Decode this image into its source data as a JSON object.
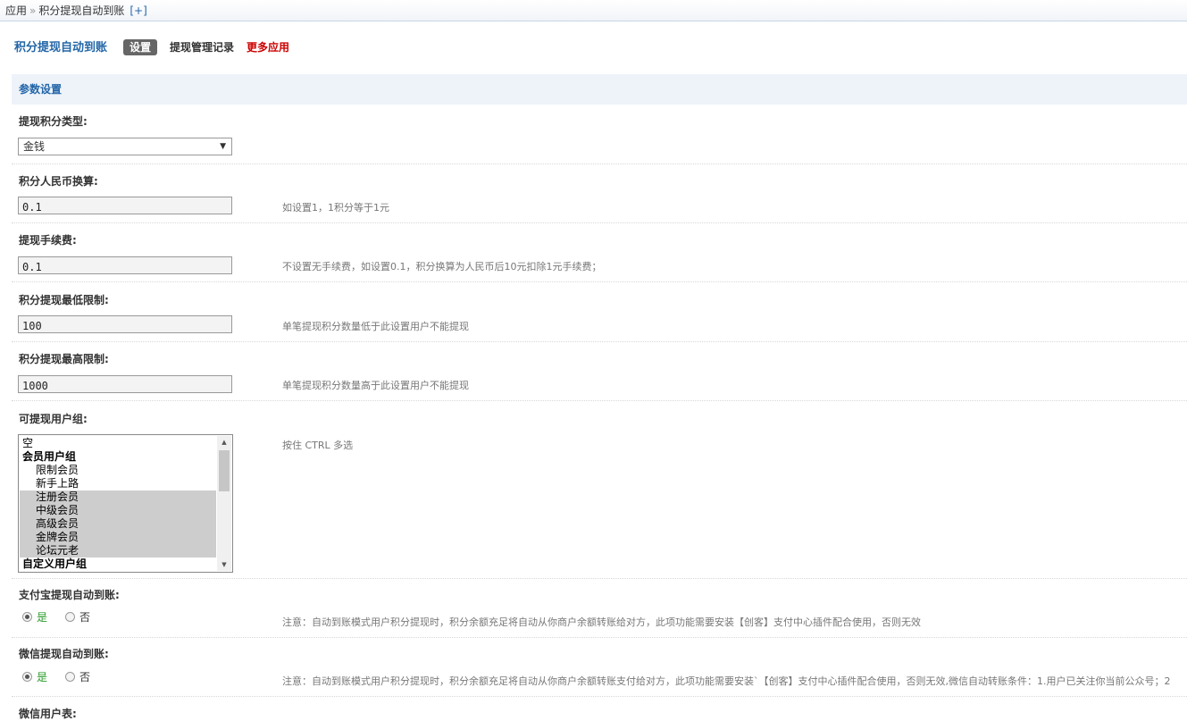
{
  "breadcrumb": {
    "root": "应用",
    "separator": "»",
    "current": "积分提现自动到账",
    "add": "[+]"
  },
  "header": {
    "title": "积分提现自动到账",
    "tabs": [
      {
        "label": "设置",
        "active": true
      },
      {
        "label": "提现管理记录",
        "active": false
      },
      {
        "label": "更多应用",
        "active": false,
        "color": "#cc0000"
      }
    ]
  },
  "section": {
    "title": "参数设置"
  },
  "settings": {
    "type": {
      "label": "提现积分类型:",
      "value": "金钱"
    },
    "rate": {
      "label": "积分人民币换算:",
      "value": "0.1",
      "tip": "如设置1，1积分等于1元"
    },
    "fee": {
      "label": "提现手续费:",
      "value": "0.1",
      "tip": "不设置无手续费，如设置0.1，积分换算为人民币后10元扣除1元手续费；"
    },
    "min": {
      "label": "积分提现最低限制:",
      "value": "100",
      "tip": "单笔提现积分数量低于此设置用户不能提现"
    },
    "max": {
      "label": "积分提现最高限制:",
      "value": "1000",
      "tip": "单笔提现积分数量高于此设置用户不能提现"
    },
    "groups": {
      "label": "可提现用户组:",
      "tip": "按住 CTRL 多选",
      "options": [
        {
          "label": "空",
          "kind": "option",
          "selected": false
        },
        {
          "label": "会员用户组",
          "kind": "group",
          "selected": false
        },
        {
          "label": "限制会员",
          "kind": "child",
          "selected": false
        },
        {
          "label": "新手上路",
          "kind": "child",
          "selected": false
        },
        {
          "label": "注册会员",
          "kind": "child",
          "selected": true
        },
        {
          "label": "中级会员",
          "kind": "child",
          "selected": true
        },
        {
          "label": "高级会员",
          "kind": "child",
          "selected": true
        },
        {
          "label": "金牌会员",
          "kind": "child",
          "selected": true
        },
        {
          "label": "论坛元老",
          "kind": "child",
          "selected": true
        },
        {
          "label": "自定义用户组",
          "kind": "group",
          "selected": false
        }
      ]
    },
    "alipay": {
      "label": "支付宝提现自动到账:",
      "yes": "是",
      "no": "否",
      "value": "yes",
      "tip": "注意：自动到账模式用户积分提现时，积分余额充足将自动从你商户余额转账给对方，此项功能需要安装【创客】支付中心插件配合使用，否则无效"
    },
    "wechat": {
      "label": "微信提现自动到账:",
      "yes": "是",
      "no": "否",
      "value": "yes",
      "tip": "注意：自动到账模式用户积分提现时，积分余额充足将自动从你商户余额转账支付给对方，此项功能需要安装`【创客】支付中心插件配合使用，否则无效,微信自动转账条件：1.用户已关注你当前公众号；2"
    },
    "wechat_table": {
      "label": "微信用户表:"
    }
  },
  "colors": {
    "accent": "#2366a8",
    "section_bg": "#eef3fa",
    "more_apps": "#cc0000",
    "yes_text": "#2a9a2a"
  }
}
